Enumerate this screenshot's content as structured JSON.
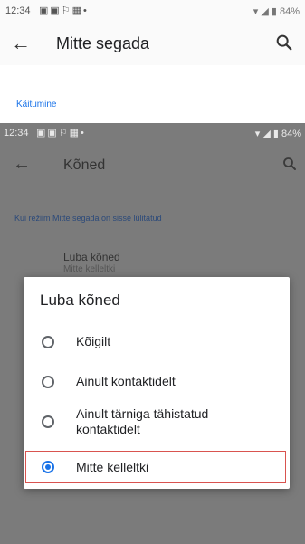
{
  "outer": {
    "status_time": "12:34",
    "status_right": "84%",
    "title": "Mitte segada",
    "section_header": "Käitumine"
  },
  "inner": {
    "status_time": "12:34",
    "status_right": "84%",
    "title": "Kõned",
    "section_header": "Kui režiim Mitte segada on sisse lülitatud",
    "pref_title": "Luba kõned",
    "pref_summary": "Mitte kelleltki"
  },
  "dialog": {
    "title": "Luba kõned",
    "options": [
      {
        "label": "Kõigilt",
        "selected": false
      },
      {
        "label": "Ainult kontaktidelt",
        "selected": false
      },
      {
        "label": "Ainult tärniga tähistatud kontaktidelt",
        "selected": false
      },
      {
        "label": "Mitte kelleltki",
        "selected": true
      }
    ]
  },
  "colors": {
    "accent": "#1a73e8",
    "highlight": "#d9534f",
    "scrim": "#7b7b7b"
  }
}
